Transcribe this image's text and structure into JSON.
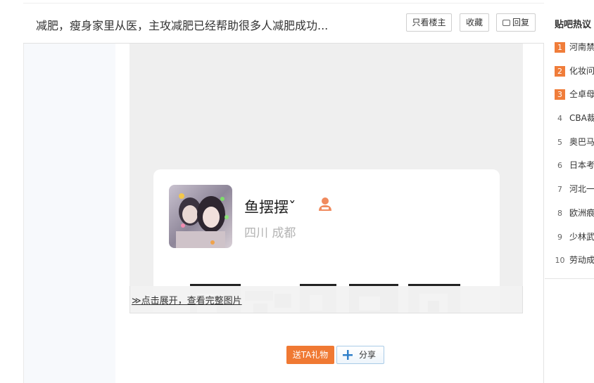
{
  "header": {
    "title": "减肥，瘦身家里从医，主攻减肥已经帮助很多人减肥成功...",
    "only_op_label": "只看楼主",
    "collect_label": "收藏",
    "reply_label": "回复"
  },
  "image_card": {
    "username": "鱼摆摆ˇ",
    "location": "四川 成都",
    "expand_text": "≫点击展开，查看完整图片"
  },
  "actions": {
    "gift_label": "送TA礼物",
    "share_label": "分享"
  },
  "sidebar": {
    "title": "贴吧热议",
    "items": [
      {
        "rank": "1",
        "text": "河南禁"
      },
      {
        "rank": "2",
        "text": "化妆问"
      },
      {
        "rank": "3",
        "text": "仝卓母"
      },
      {
        "rank": "4",
        "text": "CBA裁"
      },
      {
        "rank": "5",
        "text": "奥巴马"
      },
      {
        "rank": "6",
        "text": "日本考"
      },
      {
        "rank": "7",
        "text": "河北一"
      },
      {
        "rank": "8",
        "text": "欧洲痕"
      },
      {
        "rank": "9",
        "text": "少林武"
      },
      {
        "rank": "10",
        "text": "劳动成"
      }
    ]
  },
  "colors": {
    "accent_orange": "#f07933",
    "rank_top": "#f07d3a",
    "share_border": "#a9cbe7",
    "image_bg": "#efefef"
  }
}
